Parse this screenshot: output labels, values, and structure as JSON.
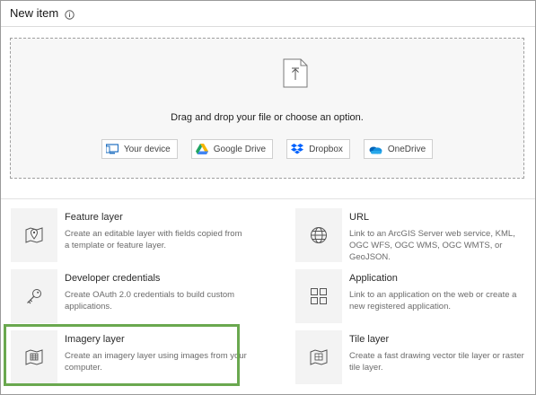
{
  "header": {
    "title": "New item",
    "info_icon": "info-icon"
  },
  "dropzone": {
    "icon": "upload-icon",
    "text": "Drag and drop your file or choose an option.",
    "sources": [
      {
        "label": "Your device",
        "icon": "device-icon"
      },
      {
        "label": "Google Drive",
        "icon": "google-drive-icon"
      },
      {
        "label": "Dropbox",
        "icon": "dropbox-icon"
      },
      {
        "label": "OneDrive",
        "icon": "onedrive-icon"
      }
    ]
  },
  "items": [
    {
      "title": "Feature layer",
      "description": "Create an editable layer with fields copied from a template or feature layer.",
      "icon": "map-pin-icon"
    },
    {
      "title": "URL",
      "description": "Link to an ArcGIS Server web service, KML, OGC WFS, OGC WMS, OGC WMTS, or GeoJSON.",
      "icon": "globe-icon"
    },
    {
      "title": "Developer credentials",
      "description": "Create OAuth 2.0 credentials to build custom applications.",
      "icon": "key-icon"
    },
    {
      "title": "Application",
      "description": "Link to an application on the web or create a new registered application.",
      "icon": "grid-icon"
    },
    {
      "title": "Imagery layer",
      "description": "Create an imagery layer using images from your computer.",
      "icon": "imagery-map-icon",
      "highlighted": true
    },
    {
      "title": "Tile layer",
      "description": "Create a fast drawing vector tile layer or raster tile layer.",
      "icon": "tile-map-icon"
    }
  ],
  "colors": {
    "highlight": "#6aa84f",
    "dropzone_bg": "#f7f7f7",
    "icon_box_bg": "#f3f3f3"
  }
}
